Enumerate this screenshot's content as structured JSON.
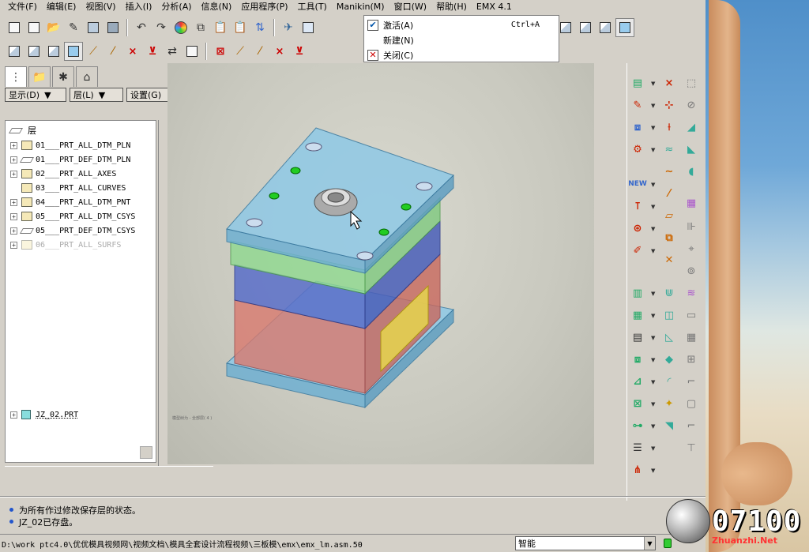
{
  "menubar": {
    "items": [
      "文件(F)",
      "编辑(E)",
      "视图(V)",
      "插入(I)",
      "分析(A)",
      "信息(N)",
      "应用程序(P)",
      "工具(T)",
      "Manikin(M)",
      "窗口(W)",
      "帮助(H)",
      "EMX 4.1"
    ]
  },
  "window_menu": {
    "items": [
      {
        "label": "激活(A)",
        "shortcut": "Ctrl+A",
        "icon": "checkmark-icon"
      },
      {
        "label": "新建(N)",
        "shortcut": "",
        "icon": ""
      },
      {
        "label": "关闭(C)",
        "shortcut": "",
        "icon": "close-icon"
      }
    ]
  },
  "navigator": {
    "buttons": {
      "show": "显示(D)",
      "layer": "层(L)",
      "settings": "设置(G)"
    },
    "root_label": "层",
    "layers": [
      {
        "name": "01___PRT_ALL_DTM_PLN",
        "enabled": true
      },
      {
        "name": "01___PRT_DEF_DTM_PLN",
        "enabled": true
      },
      {
        "name": "02___PRT_ALL_AXES",
        "enabled": true
      },
      {
        "name": "03___PRT_ALL_CURVES",
        "enabled": true
      },
      {
        "name": "04___PRT_ALL_DTM_PNT",
        "enabled": true
      },
      {
        "name": "05___PRT_ALL_DTM_CSYS",
        "enabled": true
      },
      {
        "name": "05___PRT_DEF_DTM_CSYS",
        "enabled": true
      },
      {
        "name": "06___PRT_ALL_SURFS",
        "enabled": false
      }
    ],
    "part": "JZ_02.PRT"
  },
  "graphics": {
    "note": "模型树为 - 全部层( 4 )",
    "colors": {
      "top_plate": "#8fc9e6",
      "green_plate": "#8fd98f",
      "blue_plate": "#5a6fc9",
      "red_plate": "#d97a6f",
      "yellow_block": "#e6d64f",
      "base": "#8fc9e6"
    }
  },
  "messages": [
    "为所有作过修改保存层的状态。",
    "JZ_02已存盘。"
  ],
  "status": {
    "path": "D:\\work ptc4.0\\优优模具视频网\\视频文档\\模具全套设计流程视频\\三板模\\emx\\emx_lm.asm.50",
    "filter": "智能"
  },
  "desktop": {
    "digits": "07100",
    "brand": "Zhuanzhi.Net"
  }
}
